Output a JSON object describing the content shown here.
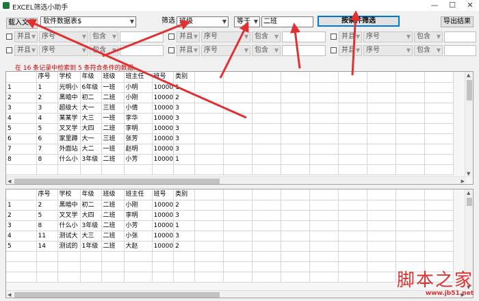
{
  "window": {
    "title": "EXCEL筛选小助手",
    "min": "—",
    "max": "☐",
    "close": "✕"
  },
  "toolbar": {
    "load_button": "载入文件",
    "sheet_select": "软件数据表$",
    "filter_label": "筛选",
    "field_select": "班级",
    "operator_select": "等于",
    "value_input": "二班",
    "filter_button": "按条件筛选",
    "export_button": "导出结果"
  },
  "conditions": {
    "logic": "并且",
    "field": "序号",
    "operator": "包含",
    "value": ""
  },
  "status": "在 16 条记录中检索到 5 条符合条件的数据。",
  "columns": [
    "序号",
    "学校",
    "年级",
    "班级",
    "班主任",
    "班号",
    "类别"
  ],
  "source_rows": [
    [
      "1",
      "1",
      "光明小",
      "6年级",
      "一班",
      "小明",
      "10000",
      "1"
    ],
    [
      "2",
      "2",
      "黑暗中",
      "初二",
      "二班",
      "小刚",
      "10000",
      "2"
    ],
    [
      "3",
      "3",
      "超级大",
      "大一",
      "三班",
      "小倩",
      "10000",
      "3"
    ],
    [
      "4",
      "4",
      "某某学",
      "大三",
      "一班",
      "李华",
      "10000",
      "3"
    ],
    [
      "5",
      "5",
      "叉叉学",
      "大四",
      "二班",
      "李明",
      "10000",
      "3"
    ],
    [
      "6",
      "6",
      "家里蹲",
      "大一",
      "三班",
      "张芳",
      "10000",
      "3"
    ],
    [
      "7",
      "7",
      "外面站",
      "大二",
      "一班",
      "赵明",
      "10000",
      "3"
    ],
    [
      "8",
      "8",
      "什么小",
      "3年级",
      "二班",
      "小芳",
      "10000",
      "1"
    ]
  ],
  "result_rows": [
    [
      "1",
      "2",
      "黑暗中",
      "初二",
      "二班",
      "小刚",
      "10000",
      "2"
    ],
    [
      "2",
      "5",
      "叉叉学",
      "大四",
      "二班",
      "李明",
      "10000",
      "3"
    ],
    [
      "3",
      "8",
      "什么小",
      "3年级",
      "二班",
      "小芳",
      "10000",
      "1"
    ],
    [
      "4",
      "11",
      "测试大",
      "大三",
      "二班",
      "小张",
      "10000",
      "3"
    ],
    [
      "5",
      "14",
      "测试的",
      "1年级",
      "二班",
      "大赵",
      "10000",
      "2"
    ]
  ],
  "watermark": {
    "big": "脚本之家",
    "small": "www.jb51.net"
  },
  "colors": {
    "accent": "#0078d7",
    "status": "#d00000",
    "arrow": "#e03030",
    "watermark": "#e03030"
  }
}
